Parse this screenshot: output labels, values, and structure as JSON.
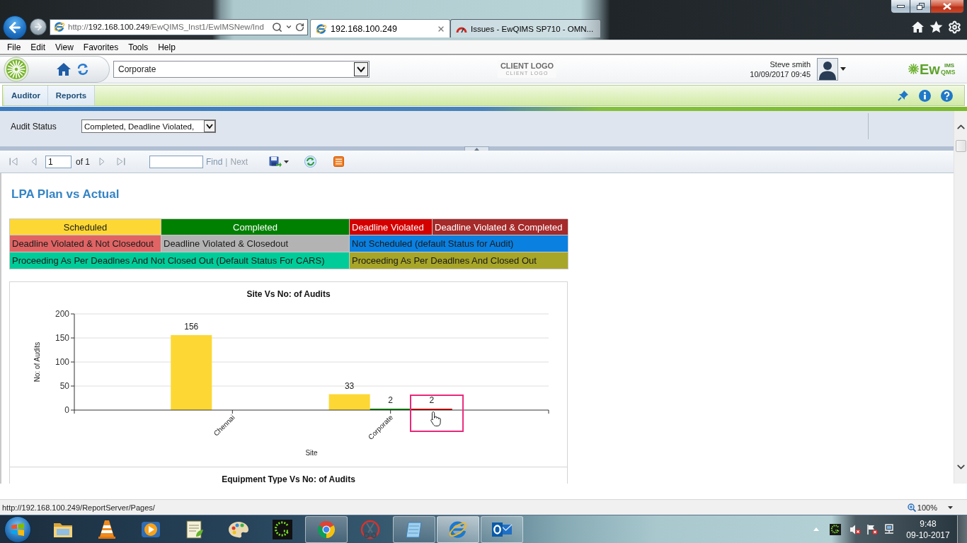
{
  "browser": {
    "address": "http://**192.168.100.249**/EwQIMS_Inst1/EwIMSNew/Ind",
    "tabs": [
      {
        "kind": "orbit_e",
        "title": "192.168.100.249",
        "selected": true
      },
      {
        "kind": "gauge",
        "title": "Issues - EwQIMS SP710 - OMN...",
        "selected": false
      }
    ],
    "menu": [
      "File",
      "Edit",
      "View",
      "Favorites",
      "Tools",
      "Help"
    ]
  },
  "header": {
    "site_select": "Corporate",
    "client_logo": {
      "text": "CLIENT LOGO",
      "reflection": "CLIENT LOGO"
    },
    "user": {
      "name": "Steve smith",
      "login_time": "10/09/2017 09:45"
    },
    "brand": {
      "main": "Ew",
      "upper": "IMS",
      "lower": "QMS"
    }
  },
  "nav": {
    "items": [
      "Auditor",
      "Reports"
    ]
  },
  "parameters": [
    {
      "label": "Audit Status",
      "value": "Completed, Deadline Violated,"
    }
  ],
  "report_toolbar": {
    "page": "1",
    "page_count": "of 1",
    "find": "Find",
    "separator": "|",
    "next": "Next"
  },
  "report": {
    "title": "LPA Plan vs Actual",
    "legend": [
      [
        {
          "label": "Scheduled",
          "color": "#fdd835"
        },
        {
          "label": "Completed",
          "color": "#008000"
        },
        {
          "label": "Deadline Violated",
          "color": "#d40000"
        },
        {
          "label": "Deadline Violated & Completed",
          "color": "#a52a2a"
        }
      ],
      [
        {
          "label": "Deadline Violated & Not Closedout",
          "color": "#e06464"
        },
        {
          "label": "Deadline Violated & Closedout",
          "color": "#b3b3b3"
        },
        {
          "label": "Not Scheduled (default Status for Audit)",
          "color": "#0a80e0"
        }
      ],
      [
        {
          "label": "Proceeding As Per Deadlnes And Not Closed Out (Default Status For CARS)",
          "color": "#00cc99"
        },
        {
          "label": "Proceeding As Per Deadlnes And Closed Out",
          "color": "#a8a628"
        }
      ]
    ],
    "site_chart": {
      "chart_data": {
        "type": "bar",
        "title": "Site Vs No: of Audits",
        "xlabel": "Site",
        "ylabel": "No: of Audits",
        "categories": [
          "Chennai",
          "Corporate"
        ],
        "series": [
          {
            "color": "#fdd835",
            "values": [
              156,
              33
            ]
          },
          {
            "color": "#008000",
            "values": [
              null,
              2
            ]
          },
          {
            "color": "#d40000",
            "values": [
              null,
              2
            ]
          }
        ],
        "ylim": [
          0,
          200
        ],
        "yticks": [
          0,
          50,
          100,
          150,
          200
        ],
        "grid": true,
        "data_labels": true
      }
    },
    "equipment_chart": {
      "title": "Equipment Type Vs No: of Audits"
    }
  },
  "status_bar": {
    "url": "http://192.168.100.249/ReportServer/Pages/",
    "zoom": "100%"
  },
  "taskbar": {
    "apps": [
      {
        "kind": "folder",
        "running": false,
        "selected": false
      },
      {
        "kind": "cone",
        "running": false,
        "selected": false
      },
      {
        "kind": "player",
        "running": false,
        "selected": false
      },
      {
        "kind": "pad_pen",
        "running": false,
        "selected": false
      },
      {
        "kind": "palette",
        "running": false,
        "selected": false
      },
      {
        "kind": "dotted_g",
        "running": false,
        "selected": false
      },
      {
        "kind": "color_wheel",
        "running": true,
        "selected": false
      },
      {
        "kind": "scissors",
        "running": false,
        "selected": false
      },
      {
        "kind": "notepad",
        "running": true,
        "selected": false
      },
      {
        "kind": "orbit_e",
        "running": true,
        "selected": true
      },
      {
        "kind": "mail",
        "running": true,
        "selected": false
      }
    ],
    "clock": {
      "time": "9:48",
      "date": "09-10-2017"
    }
  }
}
